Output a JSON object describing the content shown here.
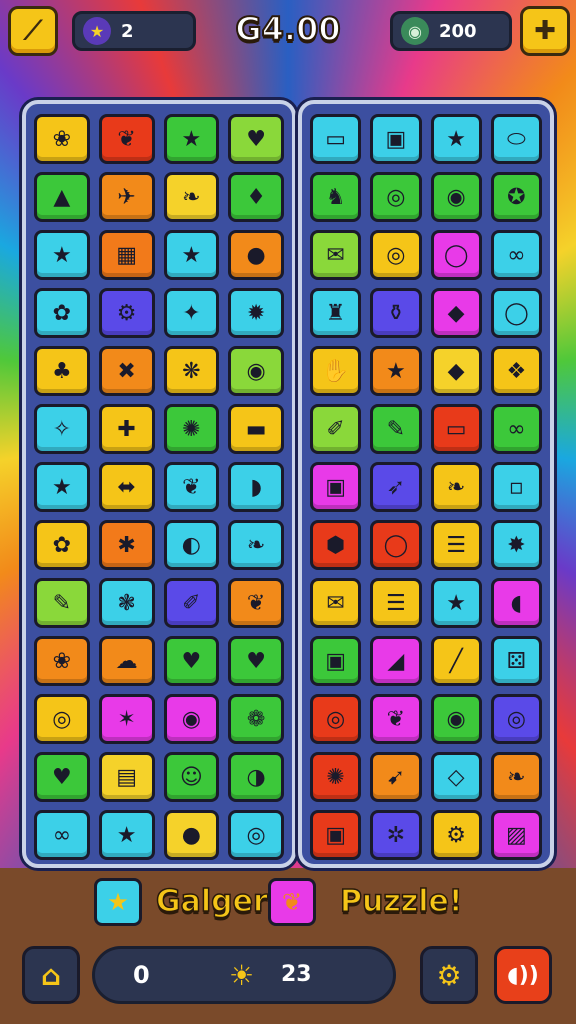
{
  "header": {
    "score": "G4.00",
    "stars_count": "2",
    "coins_count": "200",
    "back_icon": "back-arrow-icon",
    "add_icon": "plus-icon"
  },
  "boards": {
    "left": [
      {
        "icon": "❀",
        "color": "#f5c518"
      },
      {
        "icon": "❦",
        "color": "#e83a1a"
      },
      {
        "icon": "★",
        "color": "#3cc83a"
      },
      {
        "icon": "♥",
        "color": "#8ad83a"
      },
      {
        "icon": "▲",
        "color": "#3cc83a"
      },
      {
        "icon": "✈",
        "color": "#f28a1a"
      },
      {
        "icon": "❧",
        "color": "#f5d22a"
      },
      {
        "icon": "♦",
        "color": "#3cc83a"
      },
      {
        "icon": "★",
        "color": "#3cd0e8"
      },
      {
        "icon": "▦",
        "color": "#f27a1a"
      },
      {
        "icon": "★",
        "color": "#3cd0e8"
      },
      {
        "icon": "●",
        "color": "#f28a1a"
      },
      {
        "icon": "✿",
        "color": "#3cd0e8"
      },
      {
        "icon": "⚙",
        "color": "#5a4ae8"
      },
      {
        "icon": "✦",
        "color": "#3cd0e8"
      },
      {
        "icon": "✹",
        "color": "#3cd0e8"
      },
      {
        "icon": "♣",
        "color": "#f5c518"
      },
      {
        "icon": "✖",
        "color": "#f28a1a"
      },
      {
        "icon": "❋",
        "color": "#f5c518"
      },
      {
        "icon": "◉",
        "color": "#8ad83a"
      },
      {
        "icon": "✧",
        "color": "#3cd0e8"
      },
      {
        "icon": "✚",
        "color": "#f5c518"
      },
      {
        "icon": "✺",
        "color": "#3cc83a"
      },
      {
        "icon": "▬",
        "color": "#f5c518"
      },
      {
        "icon": "★",
        "color": "#3cd0e8"
      },
      {
        "icon": "⬌",
        "color": "#f5c518"
      },
      {
        "icon": "❦",
        "color": "#3cd0e8"
      },
      {
        "icon": "◗",
        "color": "#3cd0e8"
      },
      {
        "icon": "✿",
        "color": "#f5c518"
      },
      {
        "icon": "✱",
        "color": "#f27a1a"
      },
      {
        "icon": "◐",
        "color": "#3cd0e8"
      },
      {
        "icon": "❧",
        "color": "#3cd0e8"
      },
      {
        "icon": "✎",
        "color": "#8ad83a"
      },
      {
        "icon": "❃",
        "color": "#3cd0e8"
      },
      {
        "icon": "✐",
        "color": "#5a4ae8"
      },
      {
        "icon": "❦",
        "color": "#f28a1a"
      },
      {
        "icon": "❀",
        "color": "#f28a1a"
      },
      {
        "icon": "☁",
        "color": "#f28a1a"
      },
      {
        "icon": "♥",
        "color": "#3cc83a"
      },
      {
        "icon": "♥",
        "color": "#3cc83a"
      },
      {
        "icon": "◎",
        "color": "#f5c518"
      },
      {
        "icon": "✶",
        "color": "#e83ae8"
      },
      {
        "icon": "◉",
        "color": "#e83ae8"
      },
      {
        "icon": "❁",
        "color": "#3cc83a"
      },
      {
        "icon": "♥",
        "color": "#3cc83a"
      },
      {
        "icon": "▤",
        "color": "#f5d22a"
      },
      {
        "icon": "☺",
        "color": "#3cc83a"
      },
      {
        "icon": "◑",
        "color": "#3cc83a"
      },
      {
        "icon": "∞",
        "color": "#3cd0e8"
      },
      {
        "icon": "★",
        "color": "#3cd0e8"
      },
      {
        "icon": "●",
        "color": "#f5d22a"
      },
      {
        "icon": "◎",
        "color": "#3cd0e8"
      }
    ],
    "right": [
      {
        "icon": "▭",
        "color": "#3cd0e8"
      },
      {
        "icon": "▣",
        "color": "#3cd0e8"
      },
      {
        "icon": "★",
        "color": "#3cd0e8"
      },
      {
        "icon": "⬭",
        "color": "#3cd0e8"
      },
      {
        "icon": "♞",
        "color": "#3cc83a"
      },
      {
        "icon": "◎",
        "color": "#3cc83a"
      },
      {
        "icon": "◉",
        "color": "#3cc83a"
      },
      {
        "icon": "✪",
        "color": "#3cc83a"
      },
      {
        "icon": "✉",
        "color": "#8ad83a"
      },
      {
        "icon": "◎",
        "color": "#f5c518"
      },
      {
        "icon": "◯",
        "color": "#e83ae8"
      },
      {
        "icon": "∞",
        "color": "#3cd0e8"
      },
      {
        "icon": "♜",
        "color": "#3cd0e8"
      },
      {
        "icon": "⚱",
        "color": "#5a4ae8"
      },
      {
        "icon": "◆",
        "color": "#e83ae8"
      },
      {
        "icon": "◯",
        "color": "#3cd0e8"
      },
      {
        "icon": "✋",
        "color": "#f5c518"
      },
      {
        "icon": "★",
        "color": "#f28a1a"
      },
      {
        "icon": "◆",
        "color": "#f5d22a"
      },
      {
        "icon": "❖",
        "color": "#f5c518"
      },
      {
        "icon": "✐",
        "color": "#8ad83a"
      },
      {
        "icon": "✎",
        "color": "#3cc83a"
      },
      {
        "icon": "▭",
        "color": "#e83a1a"
      },
      {
        "icon": "∞",
        "color": "#3cc83a"
      },
      {
        "icon": "▣",
        "color": "#e83ae8"
      },
      {
        "icon": "➶",
        "color": "#5a4ae8"
      },
      {
        "icon": "❧",
        "color": "#f5c518"
      },
      {
        "icon": "▫",
        "color": "#3cd0e8"
      },
      {
        "icon": "⬢",
        "color": "#e83a1a"
      },
      {
        "icon": "◯",
        "color": "#e83a1a"
      },
      {
        "icon": "☰",
        "color": "#f5c518"
      },
      {
        "icon": "✸",
        "color": "#3cd0e8"
      },
      {
        "icon": "✉",
        "color": "#f5c518"
      },
      {
        "icon": "☰",
        "color": "#f5c518"
      },
      {
        "icon": "★",
        "color": "#3cd0e8"
      },
      {
        "icon": "◖",
        "color": "#e83ae8"
      },
      {
        "icon": "▣",
        "color": "#3cc83a"
      },
      {
        "icon": "◢",
        "color": "#e83ae8"
      },
      {
        "icon": "╱",
        "color": "#f5c518"
      },
      {
        "icon": "⚄",
        "color": "#3cd0e8"
      },
      {
        "icon": "◎",
        "color": "#e83a1a"
      },
      {
        "icon": "❦",
        "color": "#e83ae8"
      },
      {
        "icon": "◉",
        "color": "#3cc83a"
      },
      {
        "icon": "◎",
        "color": "#5a4ae8"
      },
      {
        "icon": "✺",
        "color": "#e83a1a"
      },
      {
        "icon": "➹",
        "color": "#f28a1a"
      },
      {
        "icon": "◇",
        "color": "#3cd0e8"
      },
      {
        "icon": "❧",
        "color": "#f28a1a"
      },
      {
        "icon": "▣",
        "color": "#e83a1a"
      },
      {
        "icon": "✲",
        "color": "#5a4ae8"
      },
      {
        "icon": "⚙",
        "color": "#f5c518"
      },
      {
        "icon": "▨",
        "color": "#e83ae8"
      }
    ]
  },
  "title_row": {
    "left_text": "Galger",
    "right_text": "Puzzle!",
    "star_icon": "★",
    "mid_icon": "❦"
  },
  "footer": {
    "left_value": "0",
    "right_value": "23",
    "home_icon": "⌂",
    "settings_icon": "⚙",
    "sound_icon": "◖))"
  }
}
